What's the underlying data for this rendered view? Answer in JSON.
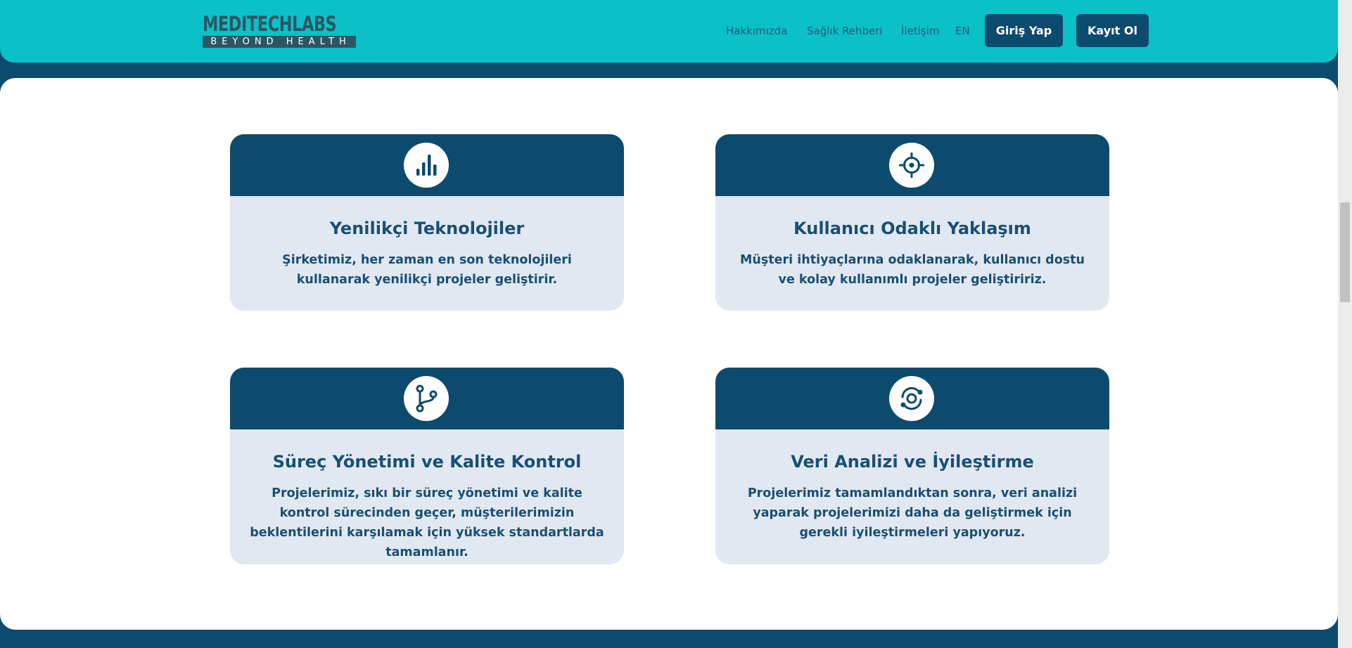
{
  "brand": {
    "name": "MEDITECHLABS",
    "tagline": "BEYOND HEALTH"
  },
  "nav": {
    "links": [
      "Hakkımızda",
      "Sağlık Rehberi",
      "İletişim",
      "EN"
    ],
    "login_label": "Giriş Yap",
    "register_label": "Kayıt Ol"
  },
  "colors": {
    "header": "#0cc0c8",
    "primary": "#0d4b6e",
    "card_body": "#e1e8f1",
    "text": "#1a4f72"
  },
  "cards": [
    {
      "icon": "bar-chart-icon",
      "title": "Yenilikçi Teknolojiler",
      "text": "Şirketimiz, her zaman en son teknolojileri kullanarak yenilikçi projeler geliştirir."
    },
    {
      "icon": "target-icon",
      "title": "Kullanıcı Odaklı Yaklaşım",
      "text": "Müşteri ihtiyaçlarına odaklanarak, kullanıcı dostu ve kolay kullanımlı projeler geliştiririz."
    },
    {
      "icon": "git-branch-icon",
      "title": "Süreç Yönetimi ve Kalite Kontrol",
      "text": "Projelerimiz, sıkı bir süreç yönetimi ve kalite kontrol sürecinden geçer, müşterilerimizin beklentilerini karşılamak için yüksek standartlarda tamamlanır."
    },
    {
      "icon": "refresh-target-icon",
      "title": "Veri Analizi ve İyileştirme",
      "text": "Projelerimiz tamamlandıktan sonra, veri analizi yaparak projelerimizi daha da geliştirmek için gerekli iyileştirmeleri yapıyoruz."
    }
  ]
}
